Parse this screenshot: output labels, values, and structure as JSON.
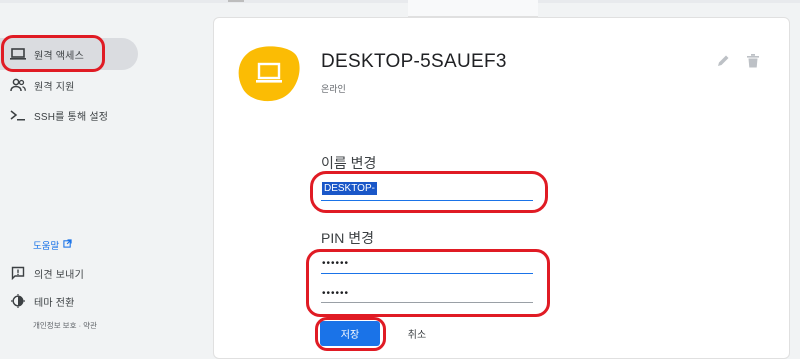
{
  "sidebar": {
    "items": [
      {
        "label": "원격 액세스",
        "icon": "laptop-icon",
        "active": true
      },
      {
        "label": "원격 지원",
        "icon": "people-icon",
        "active": false
      },
      {
        "label": "SSH를 통해 설정",
        "icon": "terminal-icon",
        "active": false
      }
    ],
    "help_label": "도움말",
    "feedback_label": "의견 보내기",
    "theme_label": "테마 전환",
    "footer_links": "개인정보 보호 · 약관"
  },
  "device": {
    "name": "DESKTOP-5SAUEF3",
    "status": "온라인"
  },
  "rename": {
    "label": "이름 변경",
    "value": "DESKTOP-"
  },
  "pin": {
    "label": "PIN 변경",
    "value_masked": "••••••",
    "confirm_masked": "••••••"
  },
  "actions": {
    "save_label": "저장",
    "cancel_label": "취소"
  },
  "colors": {
    "accent": "#1a73e8",
    "device_icon_bg": "#fbbc04",
    "annotation": "#e01b24"
  }
}
